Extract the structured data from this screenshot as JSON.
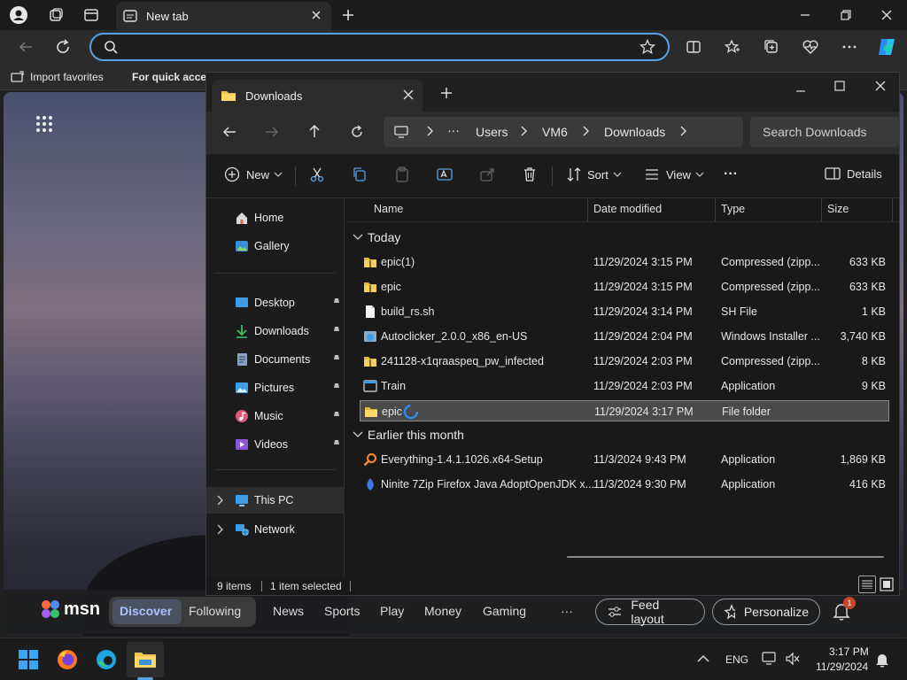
{
  "browser": {
    "tab_title": "New tab",
    "favorites": {
      "import": "Import favorites",
      "quick_access": "For quick acces"
    }
  },
  "msn": {
    "logo": "msn",
    "tabs": [
      "Discover",
      "Following",
      "News",
      "Sports",
      "Play",
      "Money",
      "Gaming"
    ],
    "more": "···",
    "feed_layout": "Feed layout",
    "personalize": "Personalize",
    "notif_count": "1"
  },
  "explorer": {
    "tab_title": "Downloads",
    "breadcrumb": {
      "more": "···",
      "items": [
        "Users",
        "VM6",
        "Downloads"
      ]
    },
    "search_placeholder": "Search Downloads",
    "commands": {
      "new": "New",
      "sort": "Sort",
      "view": "View",
      "more": "···",
      "details": "Details"
    },
    "nav": {
      "home": "Home",
      "gallery": "Gallery",
      "desktop": "Desktop",
      "downloads": "Downloads",
      "documents": "Documents",
      "pictures": "Pictures",
      "music": "Music",
      "videos": "Videos",
      "this_pc": "This PC",
      "network": "Network"
    },
    "columns": {
      "name": "Name",
      "date": "Date modified",
      "type": "Type",
      "size": "Size"
    },
    "groups": {
      "today": "Today",
      "earlier": "Earlier this month"
    },
    "today_files": [
      {
        "name": "epic(1)",
        "date": "11/29/2024 3:15 PM",
        "type": "Compressed (zipp...",
        "size": "633 KB",
        "icon": "zip-folder"
      },
      {
        "name": "epic",
        "date": "11/29/2024 3:15 PM",
        "type": "Compressed (zipp...",
        "size": "633 KB",
        "icon": "zip-folder"
      },
      {
        "name": "build_rs.sh",
        "date": "11/29/2024 3:14 PM",
        "type": "SH File",
        "size": "1 KB",
        "icon": "file"
      },
      {
        "name": "Autoclicker_2.0.0_x86_en-US",
        "date": "11/29/2024 2:04 PM",
        "type": "Windows Installer ...",
        "size": "3,740 KB",
        "icon": "installer"
      },
      {
        "name": "241128-x1qraaspeq_pw_infected",
        "date": "11/29/2024 2:03 PM",
        "type": "Compressed (zipp...",
        "size": "8 KB",
        "icon": "zip-folder"
      },
      {
        "name": "Train",
        "date": "11/29/2024 2:03 PM",
        "type": "Application",
        "size": "9 KB",
        "icon": "app"
      },
      {
        "name": "epic",
        "date": "11/29/2024 3:17 PM",
        "type": "File folder",
        "size": "",
        "icon": "folder"
      }
    ],
    "earlier_files": [
      {
        "name": "Everything-1.4.1.1026.x64-Setup",
        "date": "11/3/2024 9:43 PM",
        "type": "Application",
        "size": "1,869 KB",
        "icon": "everything"
      },
      {
        "name": "Ninite 7Zip Firefox Java AdoptOpenJDK x...",
        "date": "11/3/2024 9:30 PM",
        "type": "Application",
        "size": "416 KB",
        "icon": "ninite"
      }
    ],
    "status": {
      "items": "9 items",
      "selected": "1 item selected"
    }
  },
  "taskbar": {
    "lang": "ENG",
    "time": "3:17 PM",
    "date": "11/29/2024"
  }
}
